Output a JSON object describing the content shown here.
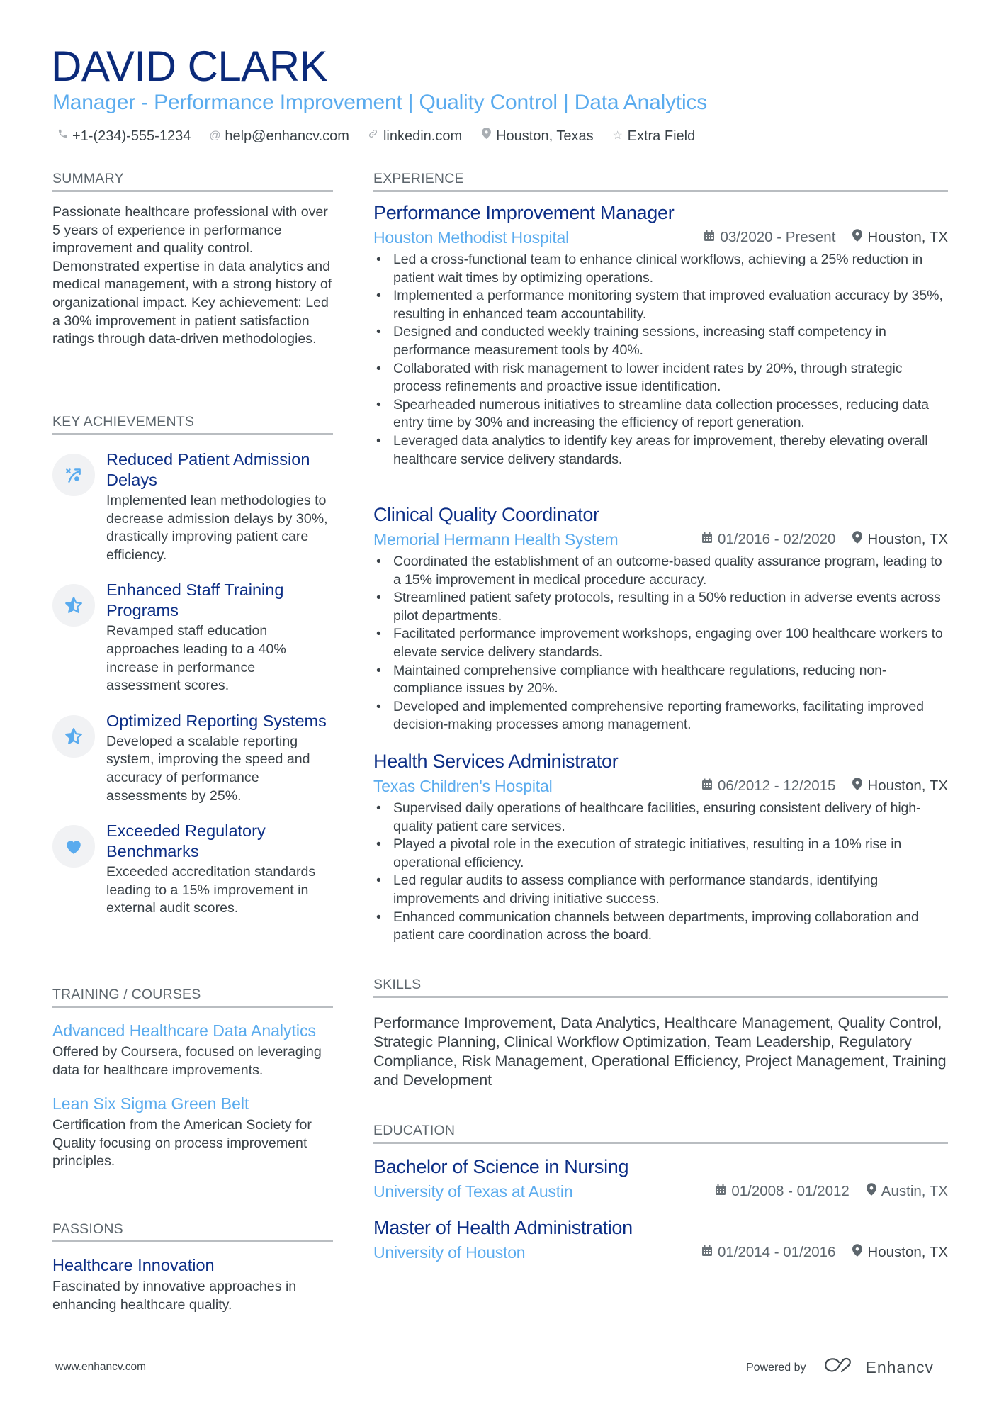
{
  "header": {
    "name": "DAVID CLARK",
    "subtitle": "Manager - Performance Improvement | Quality Control | Data Analytics",
    "contacts": [
      {
        "icon": "phone-icon",
        "text": "+1-(234)-555-1234"
      },
      {
        "icon": "at-icon",
        "text": "help@enhancv.com"
      },
      {
        "icon": "link-icon",
        "text": "linkedin.com"
      },
      {
        "icon": "location-pin-icon",
        "text": "Houston, Texas"
      },
      {
        "icon": "star-outline-icon",
        "text": "Extra Field"
      }
    ]
  },
  "sections": {
    "summary": "SUMMARY",
    "key_achievements": "KEY ACHIEVEMENTS",
    "training": "TRAINING / COURSES",
    "passions": "PASSIONS",
    "experience": "EXPERIENCE",
    "skills": "SKILLS",
    "education": "EDUCATION"
  },
  "summary": "Passionate healthcare professional with over 5 years of experience in performance improvement and quality control. Demonstrated expertise in data analytics and medical management, with a strong history of organizational impact. Key achievement: Led a 30% improvement in patient satisfaction ratings through data-driven methodologies.",
  "achievements": [
    {
      "icon": "strategy-icon",
      "title": "Reduced Patient Admission Delays",
      "desc": "Implemented lean methodologies to decrease admission delays by 30%, drastically improving patient care efficiency."
    },
    {
      "icon": "star-half-icon",
      "title": "Enhanced Staff Training Programs",
      "desc": "Revamped staff education approaches leading to a 40% increase in performance assessment scores."
    },
    {
      "icon": "star-half-icon",
      "title": "Optimized Reporting Systems",
      "desc": "Developed a scalable reporting system, improving the speed and accuracy of performance assessments by 25%."
    },
    {
      "icon": "heart-icon",
      "title": "Exceeded Regulatory Benchmarks",
      "desc": "Exceeded accreditation standards leading to a 15% improvement in external audit scores."
    }
  ],
  "training": [
    {
      "title": "Advanced Healthcare Data Analytics",
      "desc": "Offered by Coursera, focused on leveraging data for healthcare improvements."
    },
    {
      "title": "Lean Six Sigma Green Belt",
      "desc": "Certification from the American Society for Quality focusing on process improvement principles."
    }
  ],
  "passions": [
    {
      "title": "Healthcare Innovation",
      "desc": "Fascinated by innovative approaches in enhancing healthcare quality."
    }
  ],
  "experience": [
    {
      "title": "Performance Improvement Manager",
      "company": "Houston Methodist Hospital",
      "dates": "03/2020 - Present",
      "location": "Houston, TX",
      "bullets": [
        "Led a cross-functional team to enhance clinical workflows, achieving a 25% reduction in patient wait times by optimizing operations.",
        "Implemented a performance monitoring system that improved evaluation accuracy by 35%, resulting in enhanced team accountability.",
        "Designed and conducted weekly training sessions, increasing staff competency in performance measurement tools by 40%.",
        "Collaborated with risk management to lower incident rates by 20%, through strategic process refinements and proactive issue identification.",
        "Spearheaded numerous initiatives to streamline data collection processes, reducing data entry time by 30% and increasing the efficiency of report generation.",
        "Leveraged data analytics to identify key areas for improvement, thereby elevating overall healthcare service delivery standards."
      ]
    },
    {
      "title": "Clinical Quality Coordinator",
      "company": "Memorial Hermann Health System",
      "dates": "01/2016 - 02/2020",
      "location": "Houston, TX",
      "bullets": [
        "Coordinated the establishment of an outcome-based quality assurance program, leading to a 15% improvement in medical procedure accuracy.",
        "Streamlined patient safety protocols, resulting in a 50% reduction in adverse events across pilot departments.",
        "Facilitated performance improvement workshops, engaging over 100 healthcare workers to elevate service delivery standards.",
        "Maintained comprehensive compliance with healthcare regulations, reducing non-compliance issues by 20%.",
        "Developed and implemented comprehensive reporting frameworks, facilitating improved decision-making processes among management."
      ]
    },
    {
      "title": "Health Services Administrator",
      "company": "Texas Children's Hospital",
      "dates": "06/2012 - 12/2015",
      "location": "Houston, TX",
      "bullets": [
        "Supervised daily operations of healthcare facilities, ensuring consistent delivery of high-quality patient care services.",
        "Played a pivotal role in the execution of strategic initiatives, resulting in a 10% rise in operational efficiency.",
        "Led regular audits to assess compliance with performance standards, identifying improvements and driving initiative success.",
        "Enhanced communication channels between departments, improving collaboration and patient care coordination across the board."
      ]
    }
  ],
  "skills": "Performance Improvement, Data Analytics, Healthcare Management, Quality Control, Strategic Planning, Clinical Workflow Optimization, Team Leadership, Regulatory Compliance, Risk Management, Operational Efficiency, Project Management, Training and Development",
  "education": [
    {
      "degree": "Bachelor of Science in Nursing",
      "school": "University of Texas at Austin",
      "dates": "01/2008 - 01/2012",
      "location": "Austin, TX"
    },
    {
      "degree": "Master of Health Administration",
      "school": "University of Houston",
      "dates": "01/2014 - 01/2016",
      "location": "Houston, TX"
    }
  ],
  "footer": {
    "website": "www.enhancv.com",
    "powered_by": "Powered by",
    "brand": "Enhancv"
  },
  "colors": {
    "name": "#0b2a7a",
    "accent": "#5aabee",
    "heading": "#0d2f86",
    "text": "#3a4248",
    "rule": "#b9bdc1"
  }
}
